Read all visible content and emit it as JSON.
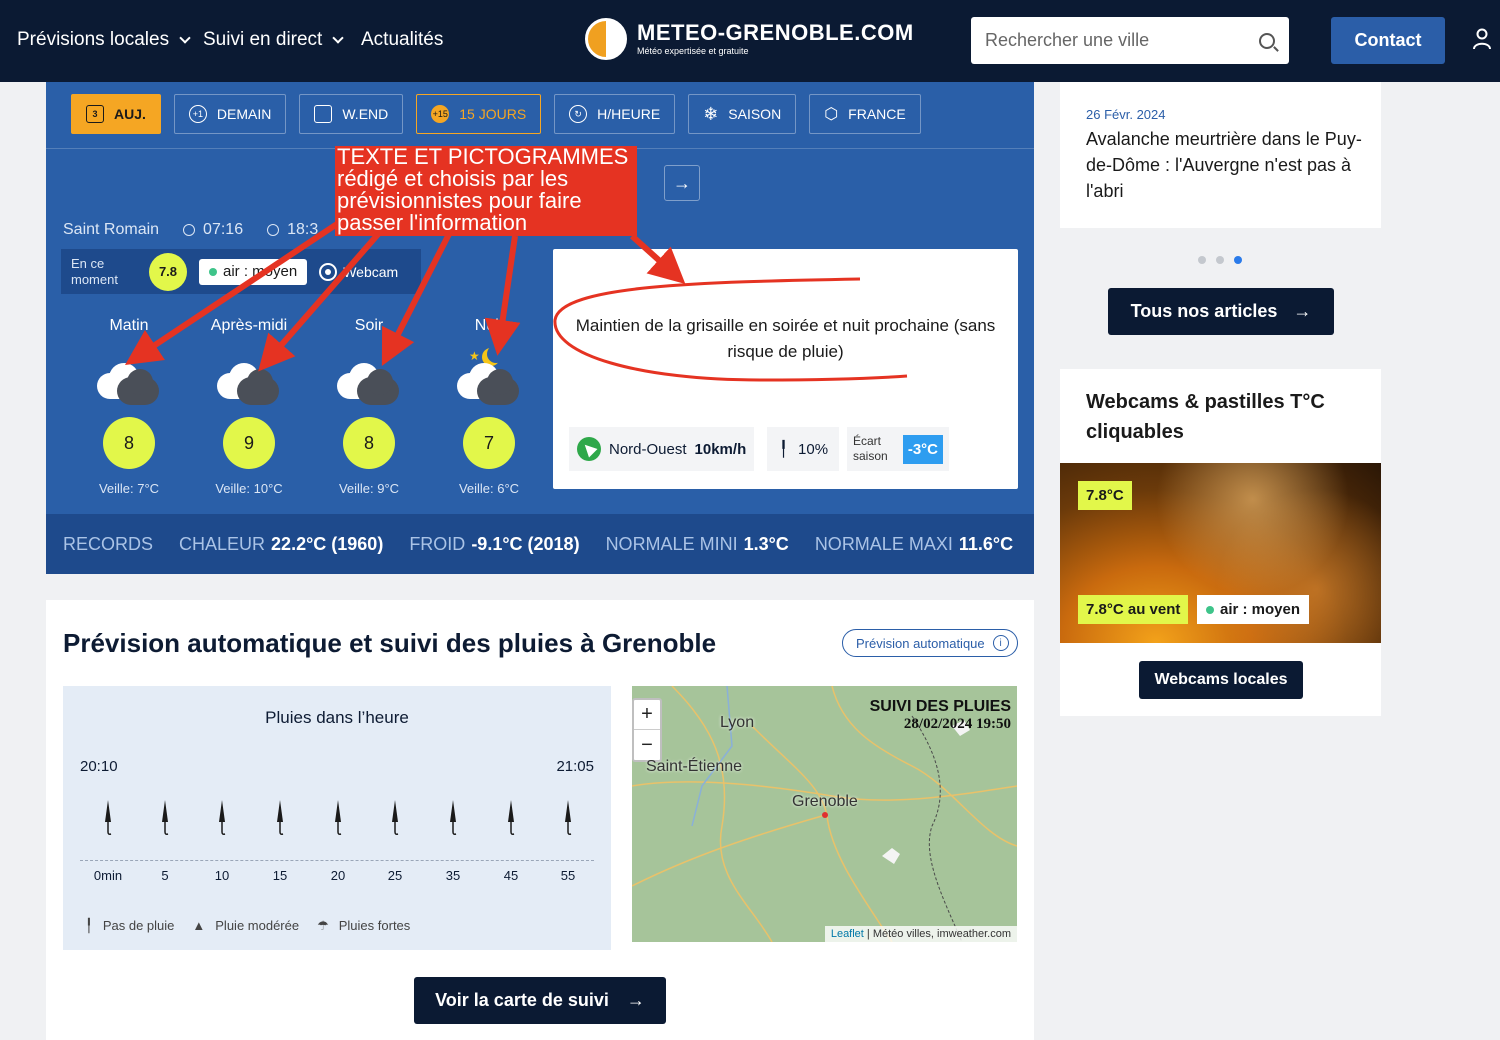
{
  "navbar": {
    "items": [
      {
        "label": "Prévisions locales",
        "has_dropdown": true
      },
      {
        "label": "Suivi en direct",
        "has_dropdown": true
      },
      {
        "label": "Actualités",
        "has_dropdown": false
      }
    ],
    "logo_title": "METEO-GRENOBLE.COM",
    "logo_subtitle": "Météo expertisée et gratuite",
    "search_placeholder": "Rechercher une ville",
    "contact_label": "Contact"
  },
  "tabs": [
    {
      "label": "AUJ.",
      "icon": "calendar-icon",
      "state": "active"
    },
    {
      "label": "DEMAIN",
      "icon": "plus-one-icon",
      "badge": "+1"
    },
    {
      "label": "W.END",
      "icon": "calendar-icon"
    },
    {
      "label": "15 JOURS",
      "icon": "plus-fifteen-icon",
      "badge": "+15",
      "state": "highlight"
    },
    {
      "label": "H/HEURE",
      "icon": "refresh-icon"
    },
    {
      "label": "SAISON",
      "icon": "snowflake-icon"
    },
    {
      "label": "FRANCE",
      "icon": "france-map-icon"
    }
  ],
  "location": {
    "name": "Saint Romain",
    "sunrise": "07:16",
    "sunset": "18:3"
  },
  "current": {
    "label": "En ce moment",
    "temp": "7.8",
    "air": "air : moyen",
    "webcam": "Webcam"
  },
  "periods": [
    {
      "name": "Matin",
      "temp": "8",
      "veille": "Veille: 7°C",
      "icon": "cloudy-icon"
    },
    {
      "name": "Après-midi",
      "temp": "9",
      "veille": "Veille: 10°C",
      "icon": "cloudy-icon"
    },
    {
      "name": "Soir",
      "temp": "8",
      "veille": "Veille: 9°C",
      "icon": "cloudy-icon"
    },
    {
      "name": "Nuit",
      "temp": "7",
      "veille": "Veille: 6°C",
      "icon": "cloudy-night-icon"
    }
  ],
  "forecast_text": "Maintien de la grisaille en soirée et nuit prochaine (sans risque de pluie)",
  "wind": {
    "direction": "Nord-Ouest",
    "speed": "10km/h"
  },
  "rain_chance": "10%",
  "ecart": {
    "label": "Écart saison",
    "value": "-3°C"
  },
  "records": {
    "label": "RECORDS",
    "chaleur_label": "CHALEUR",
    "chaleur_value": "22.2°C (1960)",
    "froid_label": "FROID",
    "froid_value": "-9.1°C (2018)",
    "normale_mini_label": "NORMALE MINI",
    "normale_mini_value": "1.3°C",
    "normale_maxi_label": "NORMALE MAXI",
    "normale_maxi_value": "11.6°C"
  },
  "annotation": {
    "text": "TEXTE ET PICTOGRAMMES rédigé et choisis par les prévisionnistes pour faire passer l'information",
    "color": "#e53322"
  },
  "rain_section": {
    "title": "Prévision automatique et suivi des pluies à Grenoble",
    "pill": "Prévision automatique",
    "hour_title": "Pluies dans l’heure",
    "start_time": "20:10",
    "end_time": "21:05",
    "ticks": [
      "0min",
      "5",
      "10",
      "15",
      "20",
      "25",
      "35",
      "45",
      "55"
    ],
    "legend": [
      "Pas de pluie",
      "Pluie modérée",
      "Pluies fortes"
    ],
    "map_title": "SUIVI DES PLUIES",
    "map_date": "28/02/2024 19:50",
    "cities": [
      "Lyon",
      "Saint-Étienne",
      "Grenoble"
    ],
    "attribution_link": "Leaflet",
    "attribution_text": " | Météo villes, imweather.com",
    "zoom_in": "+",
    "zoom_out": "−",
    "voir_label": "Voir la carte de suivi"
  },
  "article": {
    "date": "26 Févr. 2024",
    "title": "Avalanche meurtrière dans le Puy-de-Dôme : l'Auvergne n'est pas à l'abri",
    "all_label": "Tous nos articles"
  },
  "webcams": {
    "title": "Webcams & pastilles T°C cliquables",
    "temp": "7.8°C",
    "vent": "7.8°C au vent",
    "air": "air : moyen",
    "button": "Webcams locales"
  }
}
